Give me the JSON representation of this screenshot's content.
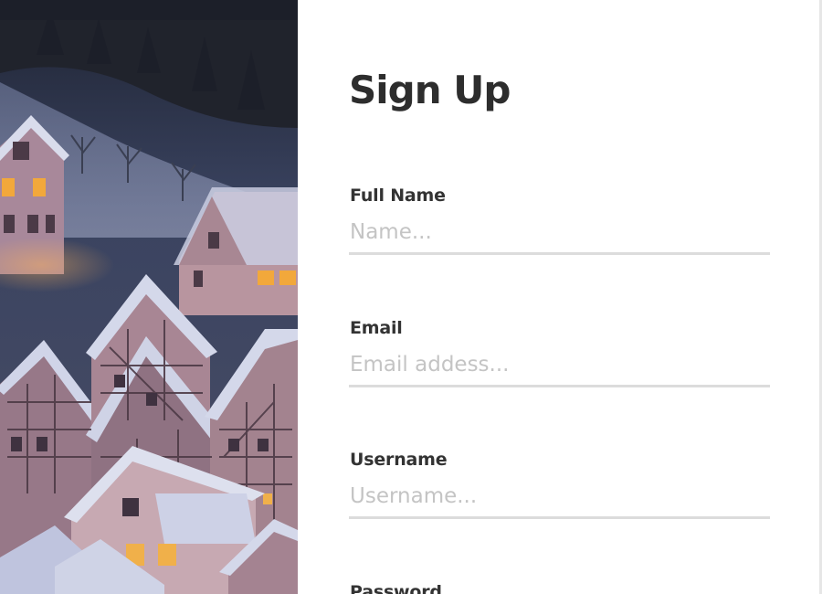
{
  "form": {
    "title": "Sign Up",
    "fields": [
      {
        "label": "Full Name",
        "placeholder": "Name...",
        "value": ""
      },
      {
        "label": "Email",
        "placeholder": "Email addess...",
        "value": ""
      },
      {
        "label": "Username",
        "placeholder": "Username...",
        "value": ""
      },
      {
        "label": "Password",
        "placeholder": "",
        "value": ""
      }
    ]
  },
  "colors": {
    "title_text": "#2d2d2d",
    "label_text": "#333333",
    "placeholder_text": "#c4c4c4",
    "input_underline": "#dcdcdc",
    "photo_night_sky": "#2b3349"
  },
  "image": {
    "subject": "snowy-village-night-photo"
  }
}
